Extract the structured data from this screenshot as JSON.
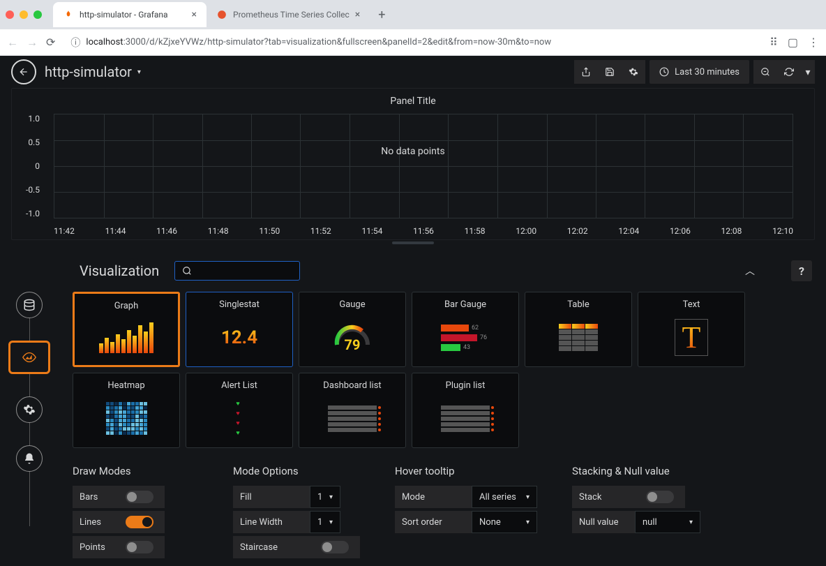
{
  "browser": {
    "tabs": [
      {
        "title": "http-simulator - Grafana",
        "active": true
      },
      {
        "title": "Prometheus Time Series Collec",
        "active": false
      }
    ],
    "url_host": "localhost",
    "url_port": ":3000",
    "url_path": "/d/kZjxeYVWz/http-simulator?tab=visualization&fullscreen&panelId=2&edit&from=now-30m&to=now"
  },
  "header": {
    "dashboard_title": "http-simulator",
    "time_range": "Last 30 minutes"
  },
  "panel": {
    "title": "Panel Title",
    "no_data": "No data points"
  },
  "chart_data": {
    "type": "line",
    "title": "Panel Title",
    "series": [],
    "ylim": [
      -1.0,
      1.0
    ],
    "y_ticks": [
      "1.0",
      "0.5",
      "0",
      "-0.5",
      "-1.0"
    ],
    "x_ticks": [
      "11:42",
      "11:44",
      "11:46",
      "11:48",
      "11:50",
      "11:52",
      "11:54",
      "11:56",
      "11:58",
      "12:00",
      "12:02",
      "12:04",
      "12:06",
      "12:08",
      "12:10"
    ],
    "message": "No data points"
  },
  "editor": {
    "tab": "Visualization",
    "help": "?",
    "viz_types": {
      "graph": "Graph",
      "singlestat": "Singlestat",
      "singlestat_value": "12.4",
      "gauge": "Gauge",
      "gauge_value": "79",
      "bar_gauge": "Bar Gauge",
      "bar_gauge_v1": "62",
      "bar_gauge_v2": "76",
      "bar_gauge_v3": "43",
      "table": "Table",
      "text": "Text",
      "heatmap": "Heatmap",
      "alert_list": "Alert List",
      "dashboard_list": "Dashboard list",
      "plugin_list": "Plugin list"
    }
  },
  "options": {
    "draw_modes": {
      "title": "Draw Modes",
      "bars": "Bars",
      "lines": "Lines",
      "points": "Points"
    },
    "mode_options": {
      "title": "Mode Options",
      "fill": "Fill",
      "fill_value": "1",
      "line_width": "Line Width",
      "line_width_value": "1",
      "staircase": "Staircase"
    },
    "hover": {
      "title": "Hover tooltip",
      "mode": "Mode",
      "mode_value": "All series",
      "sort": "Sort order",
      "sort_value": "None"
    },
    "stacking": {
      "title": "Stacking & Null value",
      "stack": "Stack",
      "null_value": "Null value",
      "null_value_value": "null"
    }
  }
}
